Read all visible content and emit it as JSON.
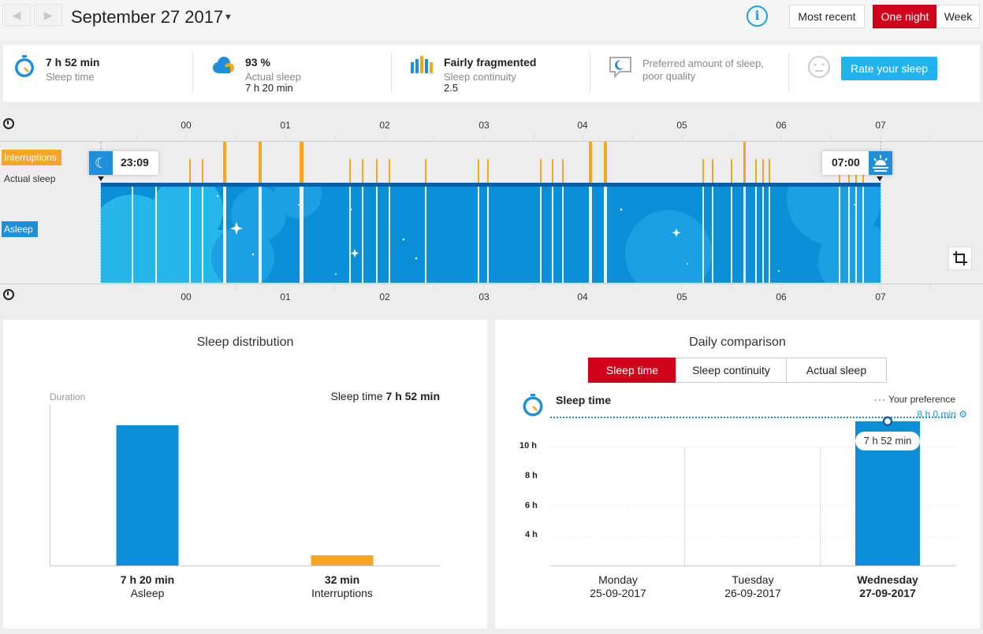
{
  "nav": {
    "prev_icon": "chevron-left-icon",
    "next_icon": "chevron-right-icon"
  },
  "header": {
    "date": "September 27 2017",
    "info_icon": "info-icon"
  },
  "view_buttons": {
    "most_recent": "Most recent",
    "one_night": "One night",
    "week": "Week",
    "active_color": "#d0021b"
  },
  "summary": {
    "sleep_time": {
      "value": "7 h 52 min",
      "label": "Sleep time"
    },
    "actual_sleep": {
      "value": "93 %",
      "label": "Actual sleep",
      "detail": "7 h 20 min"
    },
    "continuity": {
      "value": "Fairly fragmented",
      "label": "Sleep continuity",
      "detail": "2.5"
    },
    "preference": {
      "text": "Preferred amount of sleep, poor quality"
    },
    "rate_button": "Rate your sleep"
  },
  "timeline": {
    "hours": [
      "00",
      "01",
      "02",
      "03",
      "04",
      "05",
      "06",
      "07"
    ],
    "lanes": {
      "interruptions": "Interruptions",
      "actual_sleep": "Actual sleep",
      "asleep": "Asleep"
    },
    "bedtime": "23:09",
    "wakeup": "07:00",
    "interruptions_color": "#f5a623",
    "sleep_color": "#0b8fd6"
  },
  "distribution": {
    "title": "Sleep distribution",
    "axis_label": "Duration",
    "total_label": "Sleep time",
    "total_value": "7 h 52 min",
    "bars": [
      {
        "value": "7 h 20 min",
        "label": "Asleep",
        "minutes": 440,
        "color": "#0b8fd6"
      },
      {
        "value": "32 min",
        "label": "Interruptions",
        "minutes": 32,
        "color": "#f5a623"
      }
    ]
  },
  "comparison": {
    "title": "Daily comparison",
    "tabs": [
      "Sleep time",
      "Sleep continuity",
      "Actual sleep"
    ],
    "chart_title": "Sleep time",
    "preference_label": "Your preference",
    "preference_value": "8 h 0 min",
    "y_ticks": [
      "10 h",
      "8 h",
      "6 h",
      "4 h"
    ],
    "days": [
      {
        "day": "Monday",
        "date": "25-09-2017"
      },
      {
        "day": "Tuesday",
        "date": "26-09-2017"
      },
      {
        "day": "Wednesday",
        "date": "27-09-2017"
      }
    ],
    "bar_label": "7 h 52 min"
  },
  "chart_data": {
    "type": "bar",
    "categories": [
      "Monday 25-09-2017",
      "Tuesday 26-09-2017",
      "Wednesday 27-09-2017"
    ],
    "values": [
      null,
      null,
      7.87
    ],
    "ylabel": "",
    "ylim": [
      3,
      10
    ],
    "reference_line": 8
  }
}
